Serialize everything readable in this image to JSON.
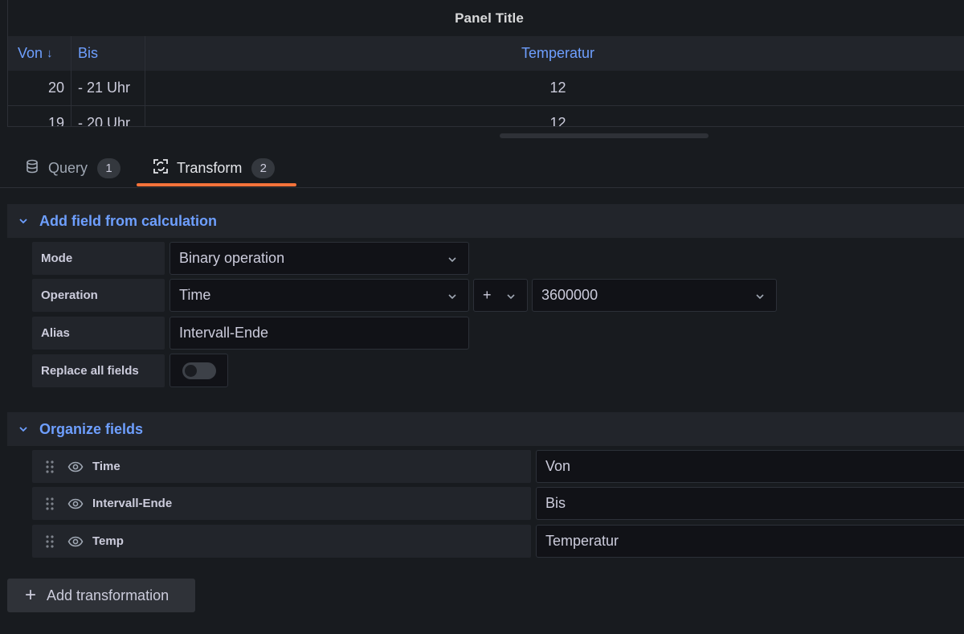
{
  "panel": {
    "title": "Panel Title",
    "columns": [
      "Von",
      "Bis",
      "Temperatur"
    ],
    "sort_indicator": "↓",
    "rows": [
      {
        "von": "20",
        "bis": "- 21 Uhr",
        "temp": "12"
      },
      {
        "von": "19",
        "bis": "- 20 Uhr",
        "temp": "12"
      }
    ]
  },
  "tabs": {
    "query": {
      "label": "Query",
      "count": "1",
      "icon": "database-icon"
    },
    "transform": {
      "label": "Transform",
      "count": "2",
      "icon": "transform-icon",
      "active": true
    }
  },
  "calc_section": {
    "title": "Add field from calculation",
    "mode_label": "Mode",
    "mode_value": "Binary operation",
    "operation_label": "Operation",
    "operation_left": "Time",
    "operation_operator": "+",
    "operation_right": "3600000",
    "alias_label": "Alias",
    "alias_value": "Intervall-Ende",
    "replace_label": "Replace all fields",
    "replace_enabled": false
  },
  "organize_section": {
    "title": "Organize fields",
    "fields": [
      {
        "name": "Time",
        "rename": "Von"
      },
      {
        "name": "Intervall-Ende",
        "rename": "Bis"
      },
      {
        "name": "Temp",
        "rename": "Temperatur"
      }
    ]
  },
  "add_transformation": {
    "label": "Add transformation"
  },
  "colors": {
    "accent_blue": "#6e9fff",
    "tab_active_underline": "#f5733a",
    "background": "#181b1f"
  }
}
